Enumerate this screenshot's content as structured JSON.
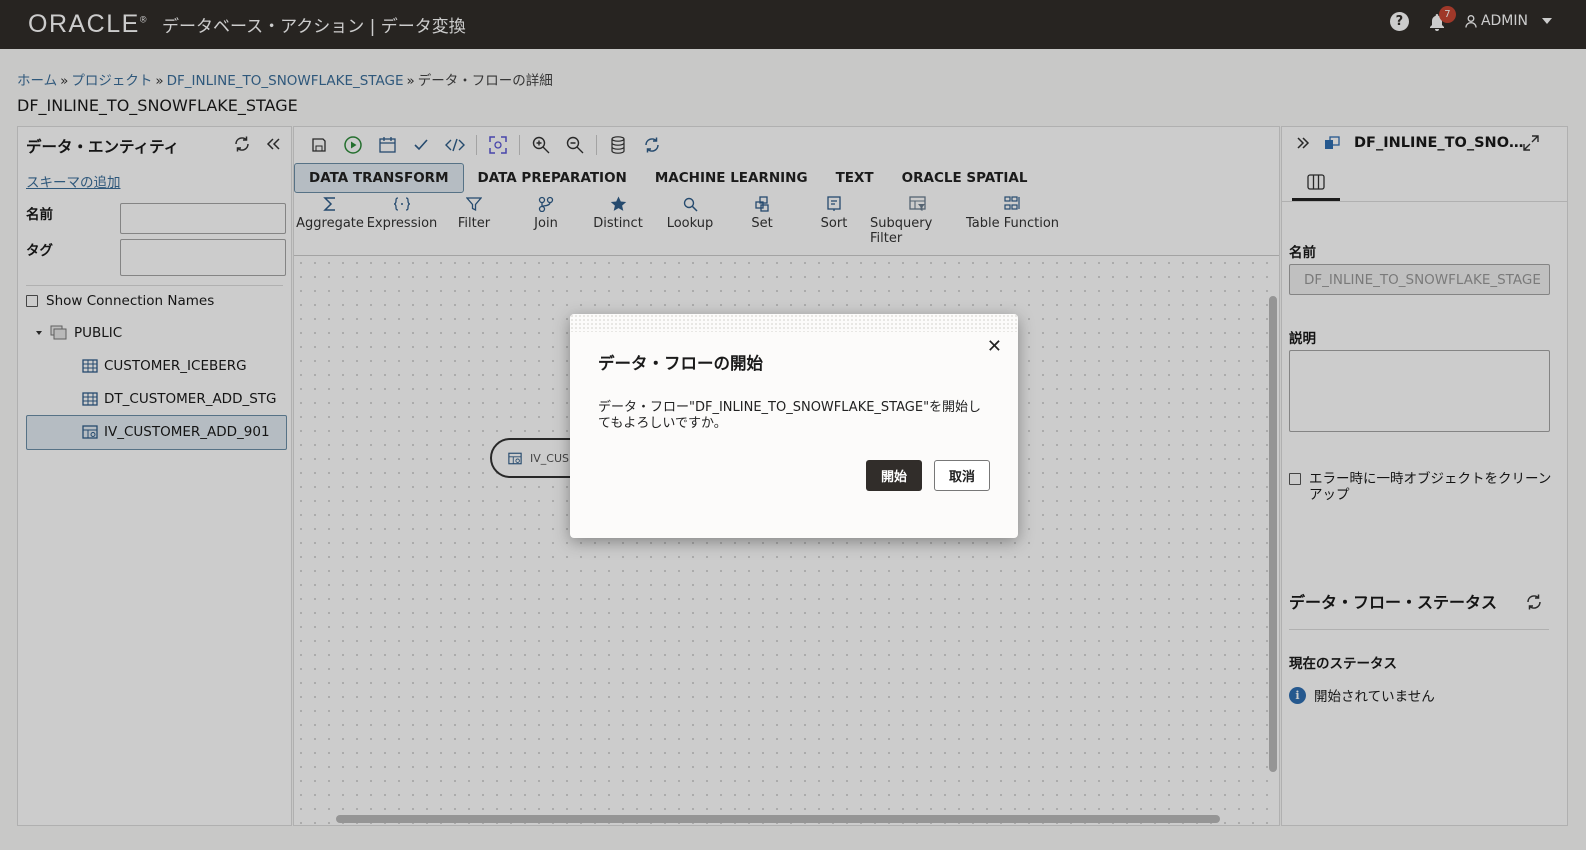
{
  "header": {
    "logo": "ORACLE",
    "app_title": "データベース・アクション | データ変換",
    "help_icon": "?",
    "notification_count": "7",
    "user": "ADMIN"
  },
  "breadcrumb": {
    "home": "ホーム",
    "projects": "プロジェクト",
    "flow": "DF_INLINE_TO_SNOWFLAKE_STAGE",
    "current": "データ・フローの詳細",
    "separator": "»"
  },
  "page_title": "DF_INLINE_TO_SNOWFLAKE_STAGE",
  "left_panel": {
    "title": "データ・エンティティ",
    "add_schema_link": "スキーマの追加",
    "name_label": "名前",
    "name_value": "",
    "tag_label": "タグ",
    "tag_value": "",
    "show_connection_names": "Show Connection Names",
    "tree": {
      "schema": "PUBLIC",
      "items": [
        "CUSTOMER_ICEBERG",
        "DT_CUSTOMER_ADD_STG",
        "IV_CUSTOMER_ADD_901"
      ]
    }
  },
  "center": {
    "tabs": [
      "DATA TRANSFORM",
      "DATA PREPARATION",
      "MACHINE LEARNING",
      "TEXT",
      "ORACLE SPATIAL"
    ],
    "active_tab": "DATA TRANSFORM",
    "operators": [
      "Aggregate",
      "Expression",
      "Filter",
      "Join",
      "Distinct",
      "Lookup",
      "Set",
      "Sort",
      "Subquery Filter",
      "Table Function"
    ],
    "node_label": "IV_CUS"
  },
  "right_panel": {
    "title": "DF_INLINE_TO_SNO…",
    "name_label": "名前",
    "name_value": "DF_INLINE_TO_SNOWFLAKE_STAGE",
    "description_label": "説明",
    "cleanup_label": "エラー時に一時オブジェクトをクリーンアップ",
    "status_title": "データ・フロー・ステータス",
    "current_status_label": "現在のステータス",
    "current_status_value": "開始されていません"
  },
  "dialog": {
    "title": "データ・フローの開始",
    "message": "データ・フロー\"DF_INLINE_TO_SNOWFLAKE_STAGE\"を開始してもよろしいですか。",
    "start_button": "開始",
    "cancel_button": "取消"
  },
  "colors": {
    "header_bg": "#312d2a",
    "link": "#3b6e9a",
    "badge": "#c74634",
    "run_icon": "#2e8b3a",
    "selection_bg": "#e3ecf3"
  }
}
